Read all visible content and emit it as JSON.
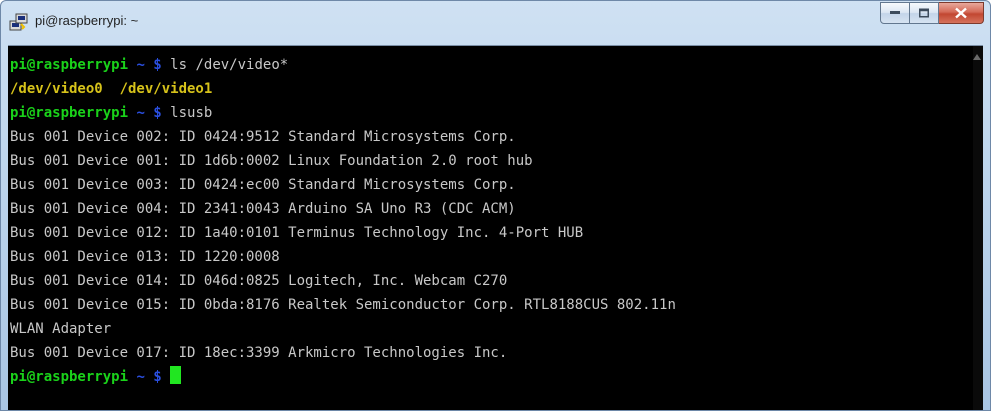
{
  "window": {
    "title": "pi@raspberrypi: ~",
    "colors": {
      "prompt_user": "#1ad21a",
      "prompt_path": "#2a4fe0",
      "dir": "#d6c21a",
      "text": "#c8c8c8",
      "cursor": "#21e621",
      "background": "#000000"
    }
  },
  "terminal": {
    "lines": [
      {
        "type": "prompt",
        "user": "pi@raspberrypi",
        "sep": " ~ $ ",
        "cmd": "ls /dev/video*"
      },
      {
        "type": "dirs",
        "items": [
          "/dev/video0",
          "/dev/video1"
        ]
      },
      {
        "type": "prompt",
        "user": "pi@raspberrypi",
        "sep": " ~ $ ",
        "cmd": "lsusb"
      },
      {
        "type": "out",
        "text": "Bus 001 Device 002: ID 0424:9512 Standard Microsystems Corp."
      },
      {
        "type": "out",
        "text": "Bus 001 Device 001: ID 1d6b:0002 Linux Foundation 2.0 root hub"
      },
      {
        "type": "out",
        "text": "Bus 001 Device 003: ID 0424:ec00 Standard Microsystems Corp."
      },
      {
        "type": "out",
        "text": "Bus 001 Device 004: ID 2341:0043 Arduino SA Uno R3 (CDC ACM)"
      },
      {
        "type": "out",
        "text": "Bus 001 Device 012: ID 1a40:0101 Terminus Technology Inc. 4-Port HUB"
      },
      {
        "type": "out",
        "text": "Bus 001 Device 013: ID 1220:0008"
      },
      {
        "type": "out",
        "text": "Bus 001 Device 014: ID 046d:0825 Logitech, Inc. Webcam C270"
      },
      {
        "type": "out",
        "text": "Bus 001 Device 015: ID 0bda:8176 Realtek Semiconductor Corp. RTL8188CUS 802.11n"
      },
      {
        "type": "out",
        "text": "WLAN Adapter"
      },
      {
        "type": "out",
        "text": "Bus 001 Device 017: ID 18ec:3399 Arkmicro Technologies Inc."
      },
      {
        "type": "prompt",
        "user": "pi@raspberrypi",
        "sep": " ~ $ ",
        "cmd": "",
        "cursor": true
      }
    ]
  }
}
